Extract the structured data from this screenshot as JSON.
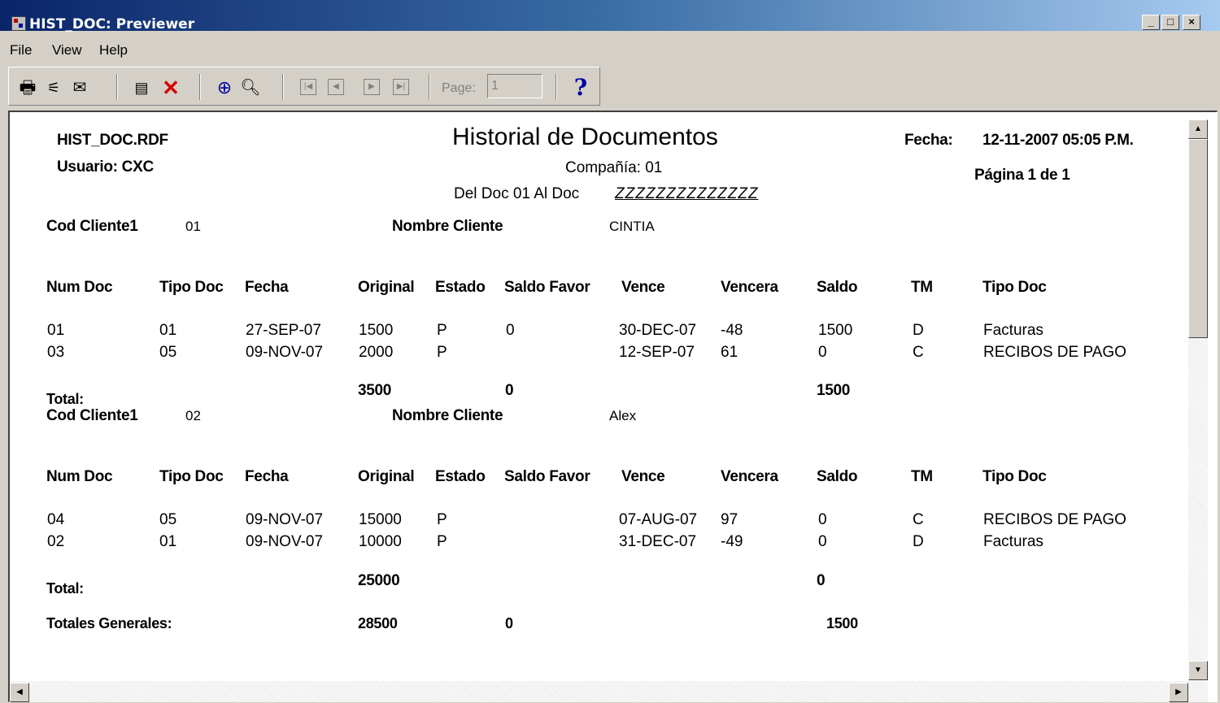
{
  "window": {
    "title": "HIST_DOC: Previewer"
  },
  "menu": [
    "File",
    "View",
    "Help"
  ],
  "toolbar": {
    "page_label": "Page:",
    "page_value": "1",
    "help_glyph": "?"
  },
  "report": {
    "file": "HIST_DOC.RDF",
    "user": "Usuario: CXC",
    "title": "Historial de Documentos",
    "company": "Compañía: 01",
    "range_prefix": "Del Doc 01 Al Doc",
    "range_end": "ZZZZZZZZZZZZZZ",
    "date_label": "Fecha:",
    "date_value": "12-11-2007 05:05 P.M.",
    "page": "Página 1 de 1",
    "columns": [
      "Num Doc",
      "Tipo Doc",
      "Fecha",
      "Original",
      "Estado",
      "Saldo Favor",
      "Vence",
      "Vencera",
      "Saldo",
      "TM",
      "Tipo Doc"
    ],
    "client_label": "Cod Cliente1",
    "name_label": "Nombre Cliente",
    "total_label": "Total:",
    "groups": [
      {
        "code": "01",
        "name": "CINTIA",
        "rows": [
          [
            "01",
            "01",
            "27-SEP-07",
            "1500",
            "P",
            "0",
            "30-DEC-07",
            "-48",
            "1500",
            "D",
            "Facturas"
          ],
          [
            "03",
            "05",
            "09-NOV-07",
            "2000",
            "P",
            "",
            "12-SEP-07",
            "61",
            "0",
            "C",
            "RECIBOS DE PAGO"
          ]
        ],
        "total_original": "3500",
        "total_favor": "0",
        "total_saldo": "1500"
      },
      {
        "code": "02",
        "name": "Alex",
        "rows": [
          [
            "04",
            "05",
            "09-NOV-07",
            "15000",
            "P",
            "",
            "07-AUG-07",
            "97",
            "0",
            "C",
            "RECIBOS DE PAGO"
          ],
          [
            "02",
            "01",
            "09-NOV-07",
            "10000",
            "P",
            "",
            "31-DEC-07",
            "-49",
            "0",
            "D",
            "Facturas"
          ]
        ],
        "total_original": "25000",
        "total_favor": "",
        "total_saldo": "0"
      }
    ],
    "grand_label": "Totales Generales:",
    "grand_original": "28500",
    "grand_favor": "0",
    "grand_saldo": "1500"
  },
  "icons": {
    "print": "printer-icon",
    "setup": "print-setup-icon",
    "mail": "mail-icon",
    "new_win": "new-window-icon",
    "close": "close-red-x-icon",
    "zoom_in": "zoom-in-icon",
    "zoom_out": "zoom-out-icon",
    "first": "first-page-icon",
    "prev": "previous-page-icon",
    "next": "next-page-icon",
    "last": "last-page-icon",
    "help": "help-question-icon"
  },
  "colors": {
    "titlebar_start": "#0a246a",
    "titlebar_end": "#a6caf0",
    "close_x": "#d40000",
    "help": "#0000a0",
    "window_bg": "#d4d0c8"
  }
}
